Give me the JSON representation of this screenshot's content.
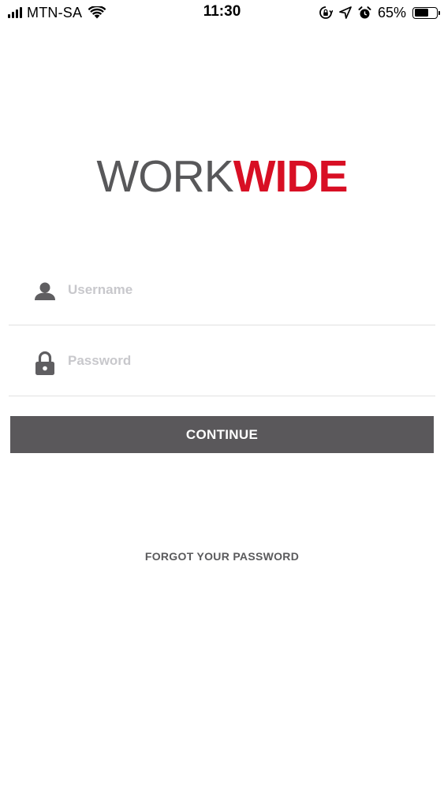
{
  "status_bar": {
    "carrier": "MTN-SA",
    "time": "11:30",
    "battery_percent": "65%",
    "battery_level": 0.65,
    "icons": [
      "signal-icon",
      "wifi-icon",
      "orientation-lock-icon",
      "location-icon",
      "alarm-icon",
      "battery-icon"
    ]
  },
  "logo": {
    "part1": "WORK",
    "part2": "WIDE",
    "color_part1": "#58585a",
    "color_part2": "#d80f24"
  },
  "login": {
    "username_placeholder": "Username",
    "username_value": "",
    "username_icon": "user-icon",
    "password_placeholder": "Password",
    "password_value": "",
    "password_icon": "lock-icon",
    "continue_label": "CONTINUE",
    "forgot_label": "FORGOT YOUR PASSWORD"
  },
  "colors": {
    "button_bg": "#5a585b",
    "icon": "#5f5e61",
    "divider": "#e1e1e1",
    "placeholder": "#c8c8cc"
  }
}
